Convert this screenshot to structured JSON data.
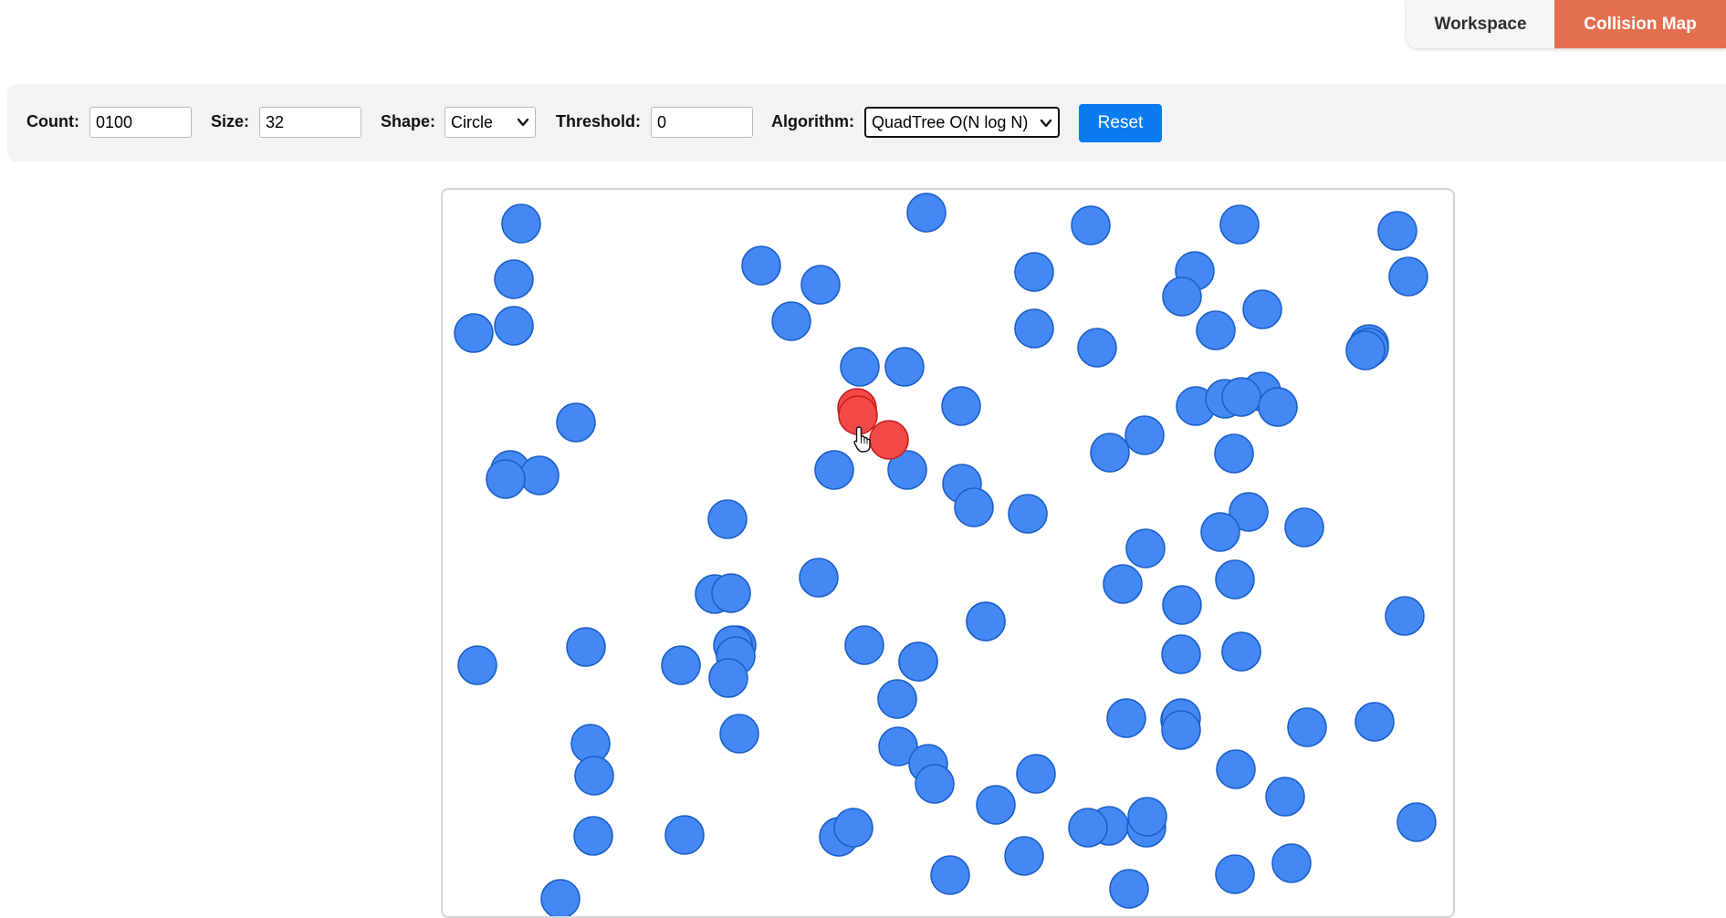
{
  "tabs": {
    "workspace": "Workspace",
    "collision_map": "Collision Map",
    "active": "collision_map"
  },
  "controls": {
    "count_label": "Count:",
    "count_value": "0100",
    "size_label": "Size:",
    "size_value": "32",
    "shape_label": "Shape:",
    "shape_value": "Circle",
    "threshold_label": "Threshold:",
    "threshold_value": "0",
    "algorithm_label": "Algorithm:",
    "algorithm_value": "QuadTree O(N log N)",
    "reset_label": "Reset"
  },
  "colors": {
    "accent_tab": "#e46f50",
    "button": "#0a7cf0",
    "circle_fill": "#4488f5",
    "circle_stroke": "#1a5fc8",
    "collision_fill": "#f24848",
    "collision_stroke": "#c81e1e"
  },
  "icons": {
    "cursor": "hand-pointer-icon",
    "select_arrow": "chevron-down-icon"
  }
}
